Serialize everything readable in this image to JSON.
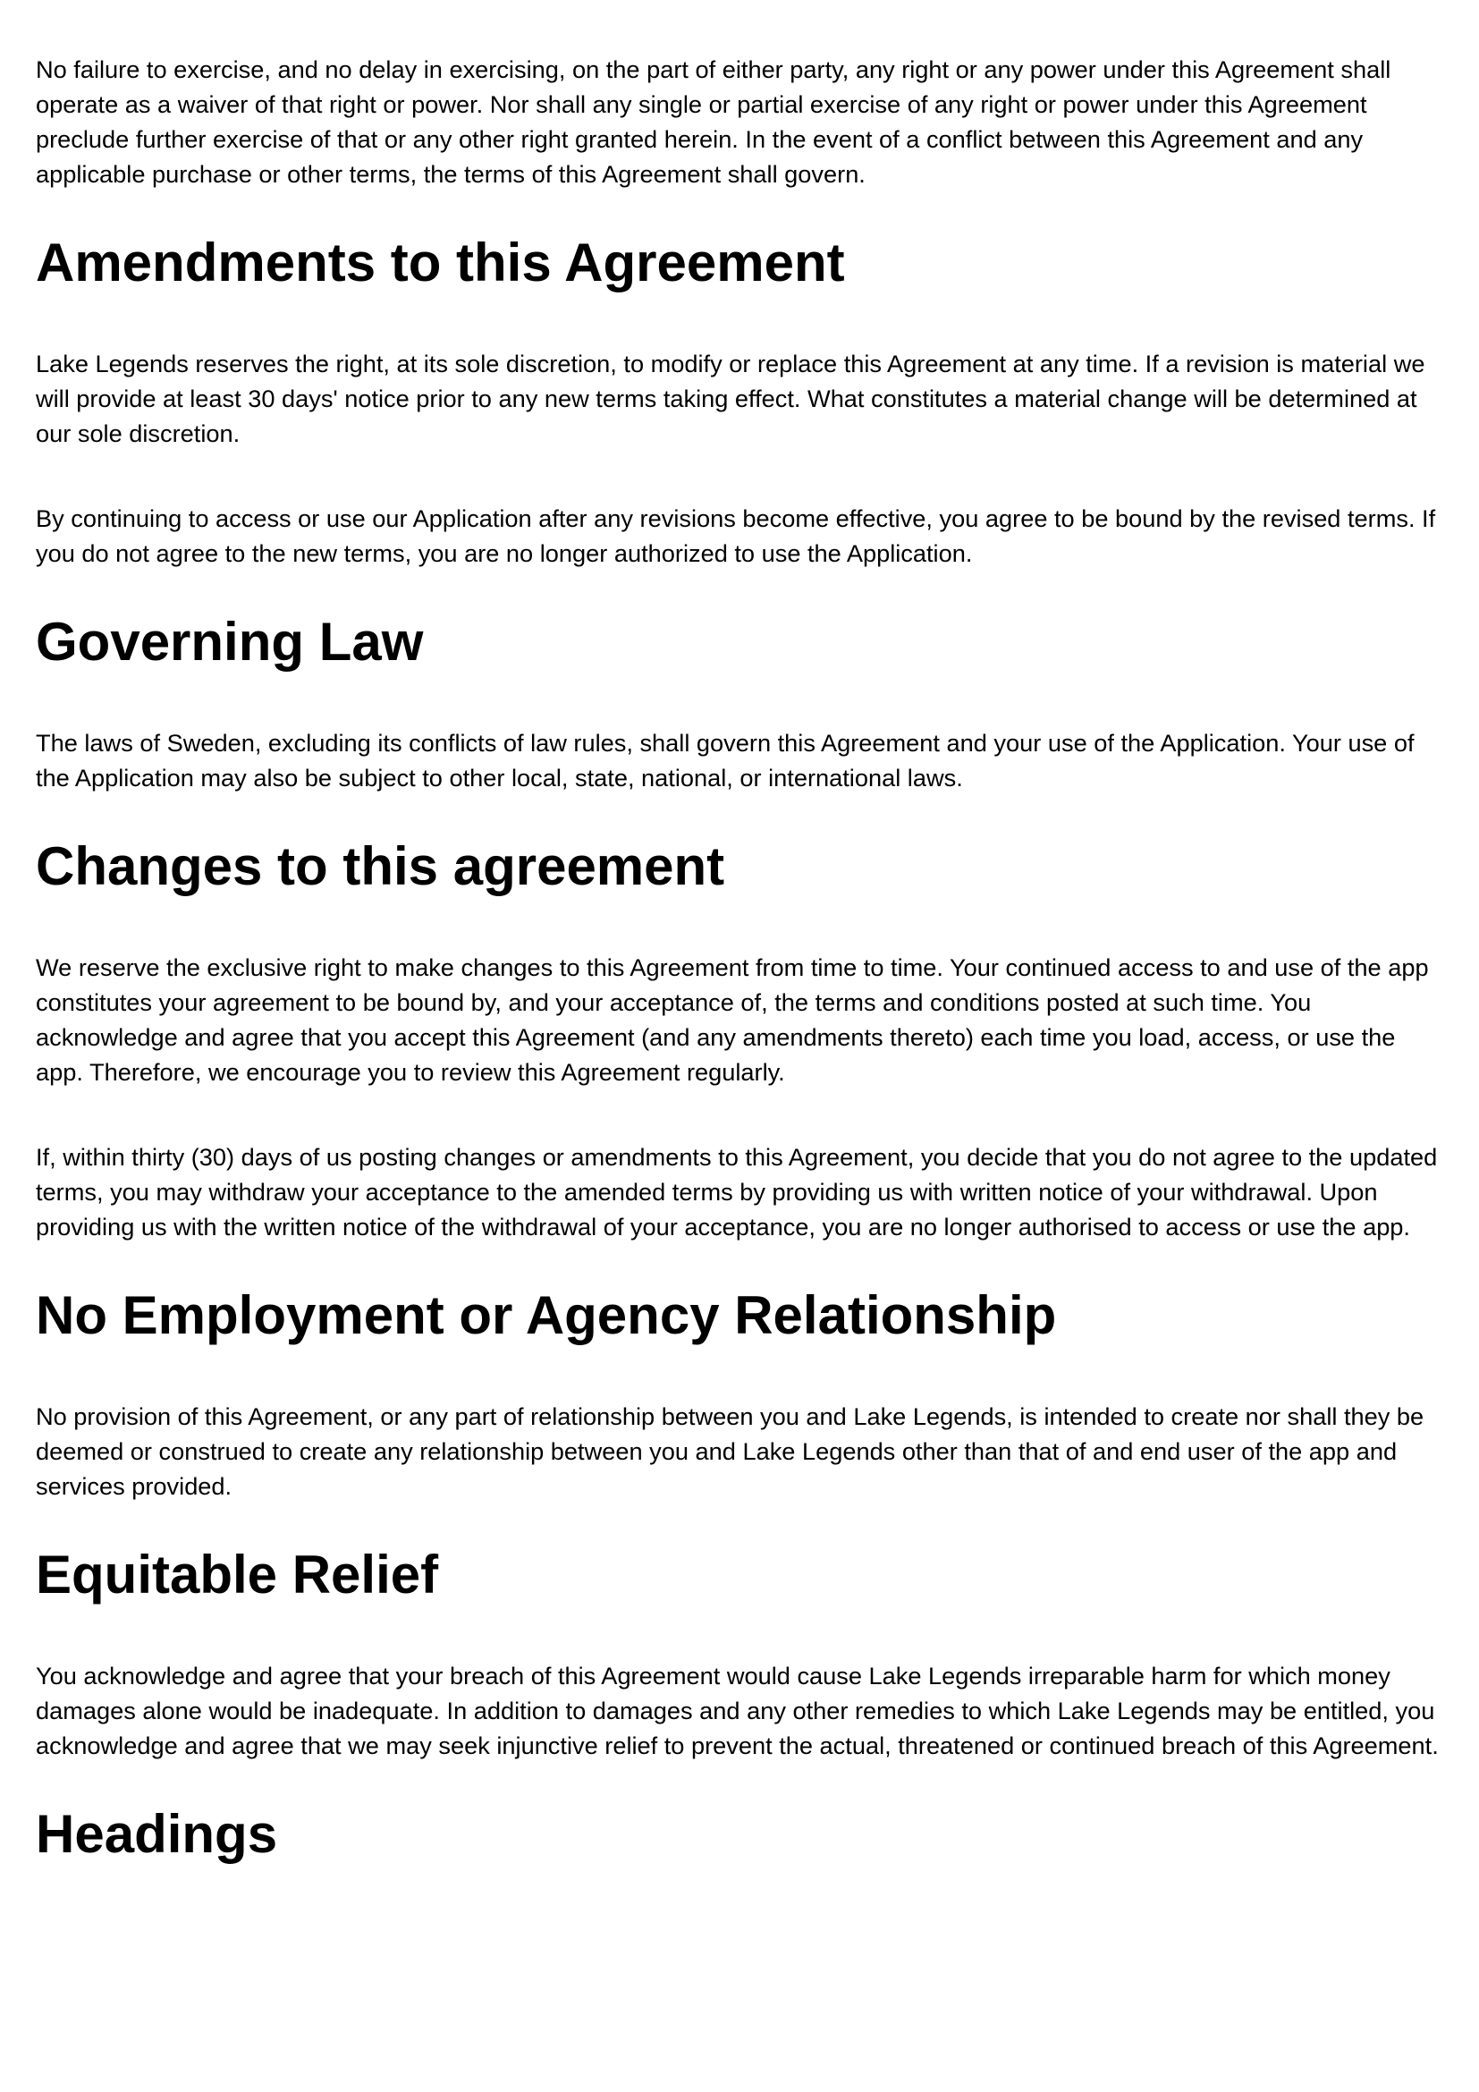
{
  "doc": {
    "p_waiver": "No failure to exercise, and no delay in exercising, on the part of either party, any right or any power under this Agreement shall operate as a waiver of that right or power. Nor shall any single or partial exercise of any right or power under this Agreement preclude further exercise of that or any other right granted herein. In the event of a conflict between this Agreement and any applicable purchase or other terms, the terms of this Agreement shall govern.",
    "h_amendments": "Amendments to this Agreement",
    "p_amendments_1": "Lake Legends reserves the right, at its sole discretion, to modify or replace this Agreement at any time. If a revision is material we will provide at least 30 days' notice prior to any new terms taking effect. What constitutes a material change will be determined at our sole discretion.",
    "p_amendments_2": "By continuing to access or use our Application after any revisions become effective, you agree to be bound by the revised terms. If you do not agree to the new terms, you are no longer authorized to use the Application.",
    "h_governing_law": "Governing Law",
    "p_governing_law": "The laws of Sweden, excluding its conflicts of law rules, shall govern this Agreement and your use of the Application. Your use of the Application may also be subject to other local, state, national, or international laws.",
    "h_changes": "Changes to this agreement",
    "p_changes_1": "We reserve the exclusive right to make changes to this Agreement from time to time. Your continued access to and use of the app constitutes your agreement to be bound by, and your acceptance of, the terms and conditions posted at such time. You acknowledge and agree that you accept this Agreement (and any amendments thereto) each time you load, access, or use the app. Therefore, we encourage you to review this Agreement regularly.",
    "p_changes_2": "If, within thirty (30) days of us posting changes or amendments to this Agreement, you decide that you do not agree to the updated terms, you may withdraw your acceptance to the amended terms by providing us with written notice of your withdrawal. Upon providing us with the written notice of the withdrawal of your acceptance, you are no longer authorised to access or use the app.",
    "h_no_employment": "No Employment or Agency Relationship",
    "p_no_employment": "No provision of this Agreement, or any part of relationship between you and Lake Legends, is intended to create nor shall they be deemed or construed to create any relationship between you and Lake Legends other than that of and end user of the app and services provided.",
    "h_equitable_relief": "Equitable Relief",
    "p_equitable_relief": "You acknowledge and agree that your breach of this Agreement would cause Lake Legends irreparable harm for which money damages alone would be inadequate. In addition to damages and any other remedies to which Lake Legends may be entitled, you acknowledge and agree that we may seek injunctive relief to prevent the actual, threatened or continued breach of this Agreement.",
    "h_headings": "Headings"
  }
}
